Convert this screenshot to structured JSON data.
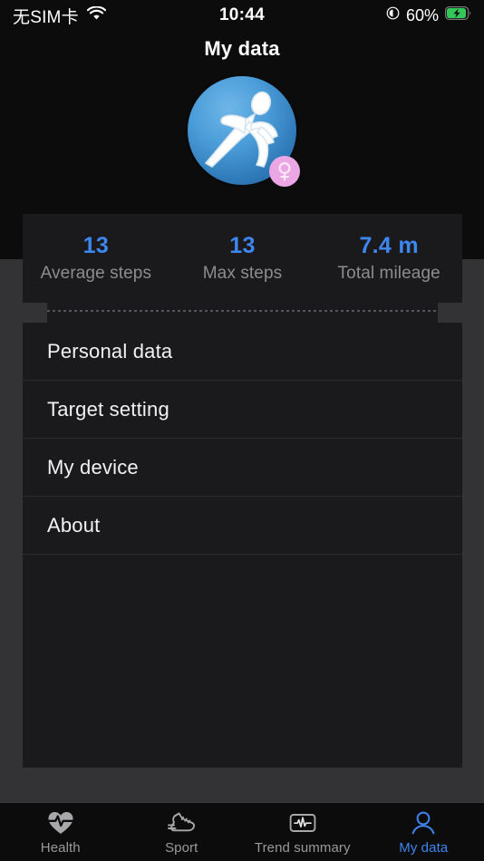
{
  "status_bar": {
    "carrier": "无SIM卡",
    "wifi_icon": "wifi-icon",
    "time": "10:44",
    "location_icon": "location-services-icon",
    "battery_percent": "60%",
    "battery_icon": "battery-charging-icon"
  },
  "header": {
    "title": "My data"
  },
  "avatar": {
    "icon": "running-person-icon",
    "gender_symbol": "♀",
    "gender": "female",
    "circle_color": "#4a9cd8",
    "badge_color": "#eaa7e3"
  },
  "stats": {
    "accent_color": "#3e86f0",
    "items": [
      {
        "value": "13",
        "label": "Average steps"
      },
      {
        "value": "13",
        "label": "Max steps"
      },
      {
        "value": "7.4 m",
        "label": "Total mileage"
      }
    ]
  },
  "menu": {
    "items": [
      {
        "label": "Personal data"
      },
      {
        "label": "Target setting"
      },
      {
        "label": "My device"
      },
      {
        "label": "About"
      }
    ]
  },
  "tabbar": {
    "active_color": "#3e86f0",
    "inactive_color": "#9a9a9d",
    "tabs": [
      {
        "label": "Health",
        "icon": "heart-pulse-icon",
        "active": false
      },
      {
        "label": "Sport",
        "icon": "sneaker-icon",
        "active": false
      },
      {
        "label": "Trend summary",
        "icon": "ecg-monitor-icon",
        "active": false
      },
      {
        "label": "My data",
        "icon": "person-icon",
        "active": true
      }
    ]
  }
}
